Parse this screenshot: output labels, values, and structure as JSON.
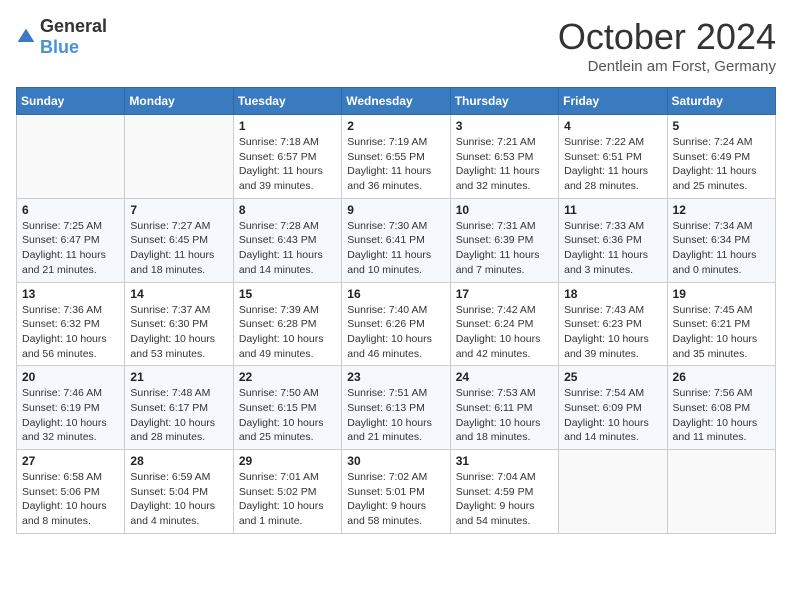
{
  "header": {
    "logo": {
      "general": "General",
      "blue": "Blue"
    },
    "title": "October 2024",
    "location": "Dentlein am Forst, Germany"
  },
  "weekdays": [
    "Sunday",
    "Monday",
    "Tuesday",
    "Wednesday",
    "Thursday",
    "Friday",
    "Saturday"
  ],
  "weeks": [
    [
      {
        "day": "",
        "sunrise": "",
        "sunset": "",
        "daylight": ""
      },
      {
        "day": "",
        "sunrise": "",
        "sunset": "",
        "daylight": ""
      },
      {
        "day": "1",
        "sunrise": "Sunrise: 7:18 AM",
        "sunset": "Sunset: 6:57 PM",
        "daylight": "Daylight: 11 hours and 39 minutes."
      },
      {
        "day": "2",
        "sunrise": "Sunrise: 7:19 AM",
        "sunset": "Sunset: 6:55 PM",
        "daylight": "Daylight: 11 hours and 36 minutes."
      },
      {
        "day": "3",
        "sunrise": "Sunrise: 7:21 AM",
        "sunset": "Sunset: 6:53 PM",
        "daylight": "Daylight: 11 hours and 32 minutes."
      },
      {
        "day": "4",
        "sunrise": "Sunrise: 7:22 AM",
        "sunset": "Sunset: 6:51 PM",
        "daylight": "Daylight: 11 hours and 28 minutes."
      },
      {
        "day": "5",
        "sunrise": "Sunrise: 7:24 AM",
        "sunset": "Sunset: 6:49 PM",
        "daylight": "Daylight: 11 hours and 25 minutes."
      }
    ],
    [
      {
        "day": "6",
        "sunrise": "Sunrise: 7:25 AM",
        "sunset": "Sunset: 6:47 PM",
        "daylight": "Daylight: 11 hours and 21 minutes."
      },
      {
        "day": "7",
        "sunrise": "Sunrise: 7:27 AM",
        "sunset": "Sunset: 6:45 PM",
        "daylight": "Daylight: 11 hours and 18 minutes."
      },
      {
        "day": "8",
        "sunrise": "Sunrise: 7:28 AM",
        "sunset": "Sunset: 6:43 PM",
        "daylight": "Daylight: 11 hours and 14 minutes."
      },
      {
        "day": "9",
        "sunrise": "Sunrise: 7:30 AM",
        "sunset": "Sunset: 6:41 PM",
        "daylight": "Daylight: 11 hours and 10 minutes."
      },
      {
        "day": "10",
        "sunrise": "Sunrise: 7:31 AM",
        "sunset": "Sunset: 6:39 PM",
        "daylight": "Daylight: 11 hours and 7 minutes."
      },
      {
        "day": "11",
        "sunrise": "Sunrise: 7:33 AM",
        "sunset": "Sunset: 6:36 PM",
        "daylight": "Daylight: 11 hours and 3 minutes."
      },
      {
        "day": "12",
        "sunrise": "Sunrise: 7:34 AM",
        "sunset": "Sunset: 6:34 PM",
        "daylight": "Daylight: 11 hours and 0 minutes."
      }
    ],
    [
      {
        "day": "13",
        "sunrise": "Sunrise: 7:36 AM",
        "sunset": "Sunset: 6:32 PM",
        "daylight": "Daylight: 10 hours and 56 minutes."
      },
      {
        "day": "14",
        "sunrise": "Sunrise: 7:37 AM",
        "sunset": "Sunset: 6:30 PM",
        "daylight": "Daylight: 10 hours and 53 minutes."
      },
      {
        "day": "15",
        "sunrise": "Sunrise: 7:39 AM",
        "sunset": "Sunset: 6:28 PM",
        "daylight": "Daylight: 10 hours and 49 minutes."
      },
      {
        "day": "16",
        "sunrise": "Sunrise: 7:40 AM",
        "sunset": "Sunset: 6:26 PM",
        "daylight": "Daylight: 10 hours and 46 minutes."
      },
      {
        "day": "17",
        "sunrise": "Sunrise: 7:42 AM",
        "sunset": "Sunset: 6:24 PM",
        "daylight": "Daylight: 10 hours and 42 minutes."
      },
      {
        "day": "18",
        "sunrise": "Sunrise: 7:43 AM",
        "sunset": "Sunset: 6:23 PM",
        "daylight": "Daylight: 10 hours and 39 minutes."
      },
      {
        "day": "19",
        "sunrise": "Sunrise: 7:45 AM",
        "sunset": "Sunset: 6:21 PM",
        "daylight": "Daylight: 10 hours and 35 minutes."
      }
    ],
    [
      {
        "day": "20",
        "sunrise": "Sunrise: 7:46 AM",
        "sunset": "Sunset: 6:19 PM",
        "daylight": "Daylight: 10 hours and 32 minutes."
      },
      {
        "day": "21",
        "sunrise": "Sunrise: 7:48 AM",
        "sunset": "Sunset: 6:17 PM",
        "daylight": "Daylight: 10 hours and 28 minutes."
      },
      {
        "day": "22",
        "sunrise": "Sunrise: 7:50 AM",
        "sunset": "Sunset: 6:15 PM",
        "daylight": "Daylight: 10 hours and 25 minutes."
      },
      {
        "day": "23",
        "sunrise": "Sunrise: 7:51 AM",
        "sunset": "Sunset: 6:13 PM",
        "daylight": "Daylight: 10 hours and 21 minutes."
      },
      {
        "day": "24",
        "sunrise": "Sunrise: 7:53 AM",
        "sunset": "Sunset: 6:11 PM",
        "daylight": "Daylight: 10 hours and 18 minutes."
      },
      {
        "day": "25",
        "sunrise": "Sunrise: 7:54 AM",
        "sunset": "Sunset: 6:09 PM",
        "daylight": "Daylight: 10 hours and 14 minutes."
      },
      {
        "day": "26",
        "sunrise": "Sunrise: 7:56 AM",
        "sunset": "Sunset: 6:08 PM",
        "daylight": "Daylight: 10 hours and 11 minutes."
      }
    ],
    [
      {
        "day": "27",
        "sunrise": "Sunrise: 6:58 AM",
        "sunset": "Sunset: 5:06 PM",
        "daylight": "Daylight: 10 hours and 8 minutes."
      },
      {
        "day": "28",
        "sunrise": "Sunrise: 6:59 AM",
        "sunset": "Sunset: 5:04 PM",
        "daylight": "Daylight: 10 hours and 4 minutes."
      },
      {
        "day": "29",
        "sunrise": "Sunrise: 7:01 AM",
        "sunset": "Sunset: 5:02 PM",
        "daylight": "Daylight: 10 hours and 1 minute."
      },
      {
        "day": "30",
        "sunrise": "Sunrise: 7:02 AM",
        "sunset": "Sunset: 5:01 PM",
        "daylight": "Daylight: 9 hours and 58 minutes."
      },
      {
        "day": "31",
        "sunrise": "Sunrise: 7:04 AM",
        "sunset": "Sunset: 4:59 PM",
        "daylight": "Daylight: 9 hours and 54 minutes."
      },
      {
        "day": "",
        "sunrise": "",
        "sunset": "",
        "daylight": ""
      },
      {
        "day": "",
        "sunrise": "",
        "sunset": "",
        "daylight": ""
      }
    ]
  ]
}
